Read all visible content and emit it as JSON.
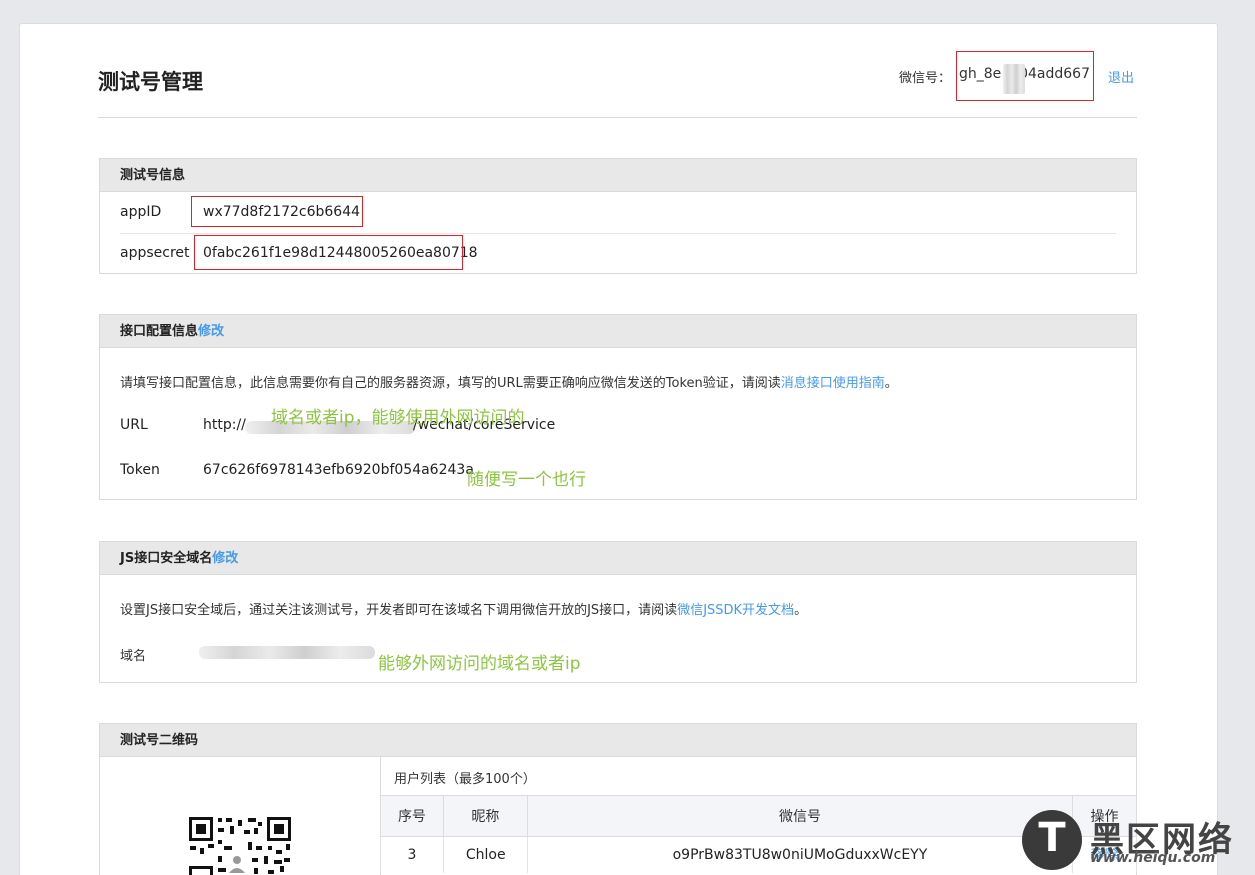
{
  "header": {
    "title": "测试号管理",
    "wechat_label": "微信号：",
    "wechat_id": "gh_8e    04add667",
    "logout": "退出"
  },
  "info": {
    "heading": "测试号信息",
    "appid_label": "appID",
    "appid_value": "wx77d8f2172c6b6644",
    "secret_label": "appsecret",
    "secret_value": "0fabc261f1e98d12448005260ea80718"
  },
  "api": {
    "heading": "接口配置信息",
    "edit": "修改",
    "desc": "请填写接口配置信息，此信息需要你有自己的服务器资源，填写的URL需要正确响应微信发送的Token验证，请阅读",
    "desc_link": "消息接口使用指南",
    "desc_end": "。",
    "url_label": "URL",
    "url_prefix": "http://",
    "url_suffix": "/wechat/coreService",
    "url_note": "域名或者ip，能够使用外网访问的",
    "token_label": "Token",
    "token_value": "67c626f6978143efb6920bf054a6243a",
    "token_note": "随便写一个也行"
  },
  "js": {
    "heading": "JS接口安全域名",
    "edit": "修改",
    "desc": "设置JS接口安全域后，通过关注该测试号，开发者即可在该域名下调用微信开放的JS接口，请阅读",
    "desc_link": "微信JSSDK开发文档",
    "desc_end": "。",
    "domain_label": "域名",
    "domain_note": "能够外网访问的域名或者ip"
  },
  "qrcode": {
    "heading": "测试号二维码",
    "user_list_title": "用户列表（最多100个）",
    "columns": [
      "序号",
      "昵称",
      "微信号",
      "操作"
    ],
    "rows": [
      {
        "index": "3",
        "nickname": "Chloe",
        "wechat": "o9PrBw83TU8w0niUMoGduxxWcEYY",
        "action": "移除"
      }
    ]
  },
  "watermark": {
    "logo": "T",
    "text": "黑区网络",
    "url": "www.heiqu.com"
  }
}
